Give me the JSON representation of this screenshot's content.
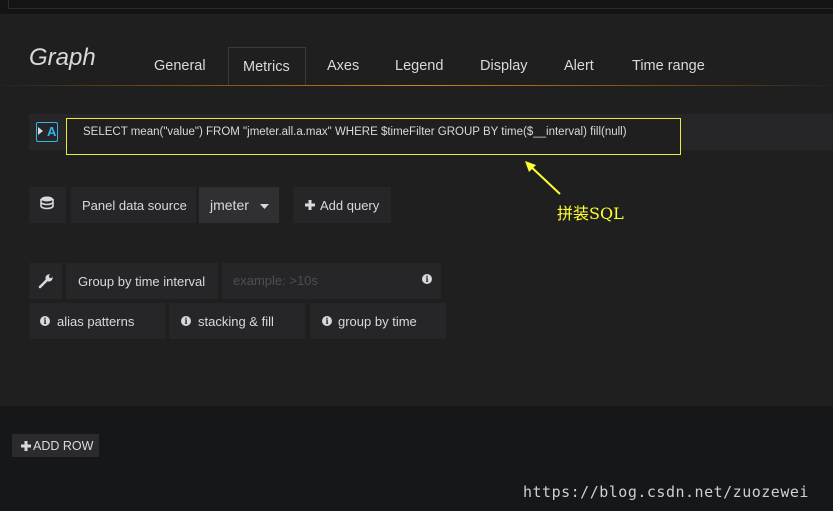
{
  "panel": {
    "title": "Graph",
    "tabs": [
      "General",
      "Metrics",
      "Axes",
      "Legend",
      "Display",
      "Alert",
      "Time range"
    ],
    "active_tab": "Metrics"
  },
  "query": {
    "ref_id": "A",
    "sql": "SELECT mean(\"value\") FROM \"jmeter.all.a.max\" WHERE $timeFilter GROUP BY time($__interval) fill(null)"
  },
  "annotation": {
    "text": "拼装SQL",
    "color": "#ffff33"
  },
  "datasource": {
    "label": "Panel data source",
    "selected": "jmeter",
    "add_query_label": "Add query"
  },
  "options": {
    "group_by_label": "Group by time interval",
    "group_by_placeholder": "example: >10s",
    "help_buttons": [
      "alias patterns",
      "stacking & fill",
      "group by time"
    ]
  },
  "footer": {
    "add_row_label": "ADD ROW",
    "watermark": "https://blog.csdn.net/zuozewei"
  },
  "colors": {
    "accent": "#eb7b18",
    "highlight_border": "#ecec3a",
    "query_letter": "#33b5e5"
  },
  "icons": [
    "database-icon",
    "wrench-icon",
    "info-icon",
    "plus-icon",
    "caret-down-icon",
    "caret-right-icon"
  ]
}
